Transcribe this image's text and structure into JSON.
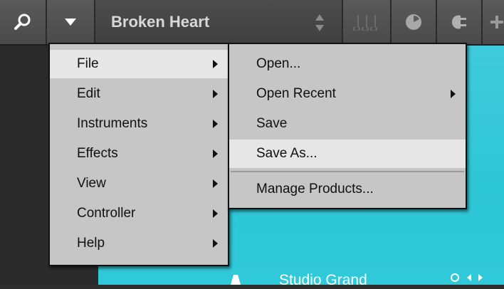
{
  "toolbar": {
    "preset_name": "Broken Heart",
    "icons": [
      "search-icon",
      "triangle-down-icon",
      "up-down-arrows-icon",
      "notes-icon",
      "clock-icon",
      "plug-icon",
      "plus-icon"
    ]
  },
  "main_menu": {
    "items": [
      {
        "label": "File",
        "submenu": true,
        "highlighted": true
      },
      {
        "label": "Edit",
        "submenu": true
      },
      {
        "label": "Instruments",
        "submenu": true
      },
      {
        "label": "Effects",
        "submenu": true
      },
      {
        "label": "View",
        "submenu": true
      },
      {
        "label": "Controller",
        "submenu": true
      },
      {
        "label": "Help",
        "submenu": true
      }
    ]
  },
  "file_menu": {
    "items": [
      {
        "label": "Open..."
      },
      {
        "label": "Open Recent",
        "submenu": true
      },
      {
        "label": "Save"
      },
      {
        "label": "Save As...",
        "highlighted": true
      },
      {
        "label": "Manage Products..."
      }
    ]
  },
  "content": {
    "instrument_name": "Studio Grand",
    "accent_color": "#2dc6d6"
  }
}
